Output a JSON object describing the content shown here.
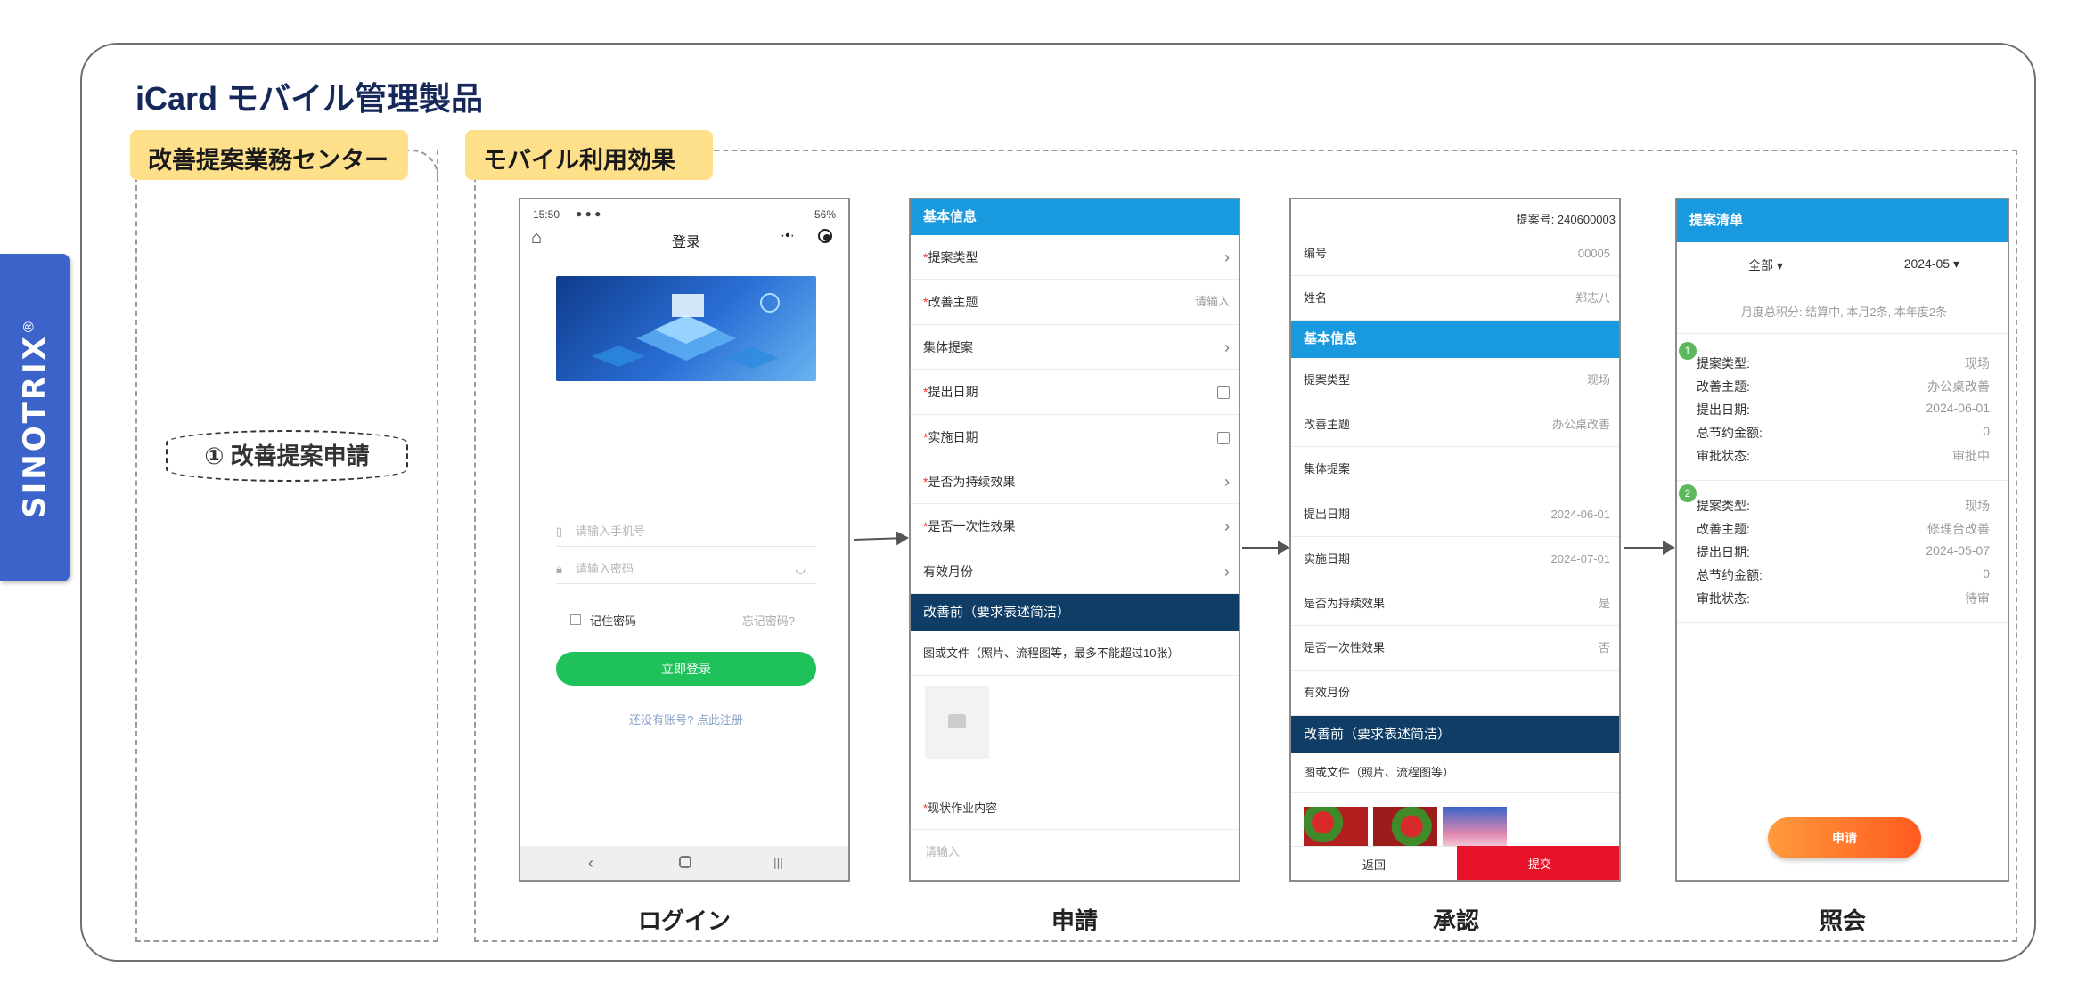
{
  "brand": {
    "name": "SINOTRIX",
    "mark": "®"
  },
  "title": "iCard モバイル管理製品",
  "left_section": {
    "label": "改善提案業務センター",
    "step": "① 改善提案申請"
  },
  "right_section": {
    "label": "モバイル利用効果"
  },
  "captions": {
    "login": "ログイン",
    "apply": "申請",
    "approve": "承認",
    "query": "照会"
  },
  "login_screen": {
    "time": "15:50",
    "status_right": "56%",
    "page_title": "登录",
    "phone_placeholder": "请输入手机号",
    "password_placeholder": "请输入密码",
    "remember": "记住密码",
    "forgot": "忘记密码?",
    "login_button": "立即登录",
    "register": "还没有账号? 点此注册"
  },
  "apply_screen": {
    "header": "基本信息",
    "rows": [
      {
        "label": "提案类型",
        "required": "*",
        "value": ""
      },
      {
        "label": "改善主题",
        "required": "*",
        "value": "请输入"
      },
      {
        "label": "集体提案",
        "required": "",
        "value": ""
      },
      {
        "label": "提出日期",
        "required": "*",
        "value": ""
      },
      {
        "label": "实施日期",
        "required": "*",
        "value": ""
      },
      {
        "label": "是否为持续效果",
        "required": "*",
        "value": ""
      },
      {
        "label": "是否一次性效果",
        "required": "*",
        "value": ""
      },
      {
        "label": "有效月份",
        "required": "",
        "value": ""
      }
    ],
    "section2": "改善前（要求表述简洁）",
    "files_label": "图或文件（照片、流程图等，最多不能超过10张）",
    "current_label": "现状作业内容",
    "current_placeholder": "请输入"
  },
  "approve_screen": {
    "proposal_no": "提案号: 240600003",
    "top_rows": [
      {
        "label": "编号",
        "value": "00005"
      },
      {
        "label": "姓名",
        "value": "郑志八"
      }
    ],
    "header": "基本信息",
    "rows": [
      {
        "label": "提案类型",
        "value": "现场"
      },
      {
        "label": "改善主题",
        "value": "办公桌改善"
      },
      {
        "label": "集体提案",
        "value": ""
      },
      {
        "label": "提出日期",
        "value": "2024-06-01"
      },
      {
        "label": "实施日期",
        "value": "2024-07-01"
      },
      {
        "label": "是否为持续效果",
        "value": "是"
      },
      {
        "label": "是否一次性效果",
        "value": "否"
      },
      {
        "label": "有效月份",
        "value": ""
      }
    ],
    "section2": "改善前（要求表述简洁）",
    "files_label": "图或文件（照片、流程图等）",
    "back_button": "返回",
    "submit_button": "提交"
  },
  "query_screen": {
    "header": "提案清单",
    "filter_all": "全部",
    "filter_month": "2024-05",
    "summary": "月度总积分: 结算中, 本月2条, 本年度2条",
    "items": [
      {
        "no": "1",
        "fields": [
          {
            "label": "提案类型:",
            "value": "现场"
          },
          {
            "label": "改善主题:",
            "value": "办公桌改善"
          },
          {
            "label": "提出日期:",
            "value": "2024-06-01"
          },
          {
            "label": "总节约金额:",
            "value": "0"
          },
          {
            "label": "审批状态:",
            "value": "审批中"
          }
        ]
      },
      {
        "no": "2",
        "fields": [
          {
            "label": "提案类型:",
            "value": "现场"
          },
          {
            "label": "改善主题:",
            "value": "修理台改善"
          },
          {
            "label": "提出日期:",
            "value": "2024-05-07"
          },
          {
            "label": "总节约金额:",
            "value": "0"
          },
          {
            "label": "审批状态:",
            "value": "待审"
          }
        ]
      }
    ],
    "apply_button": "申请"
  }
}
